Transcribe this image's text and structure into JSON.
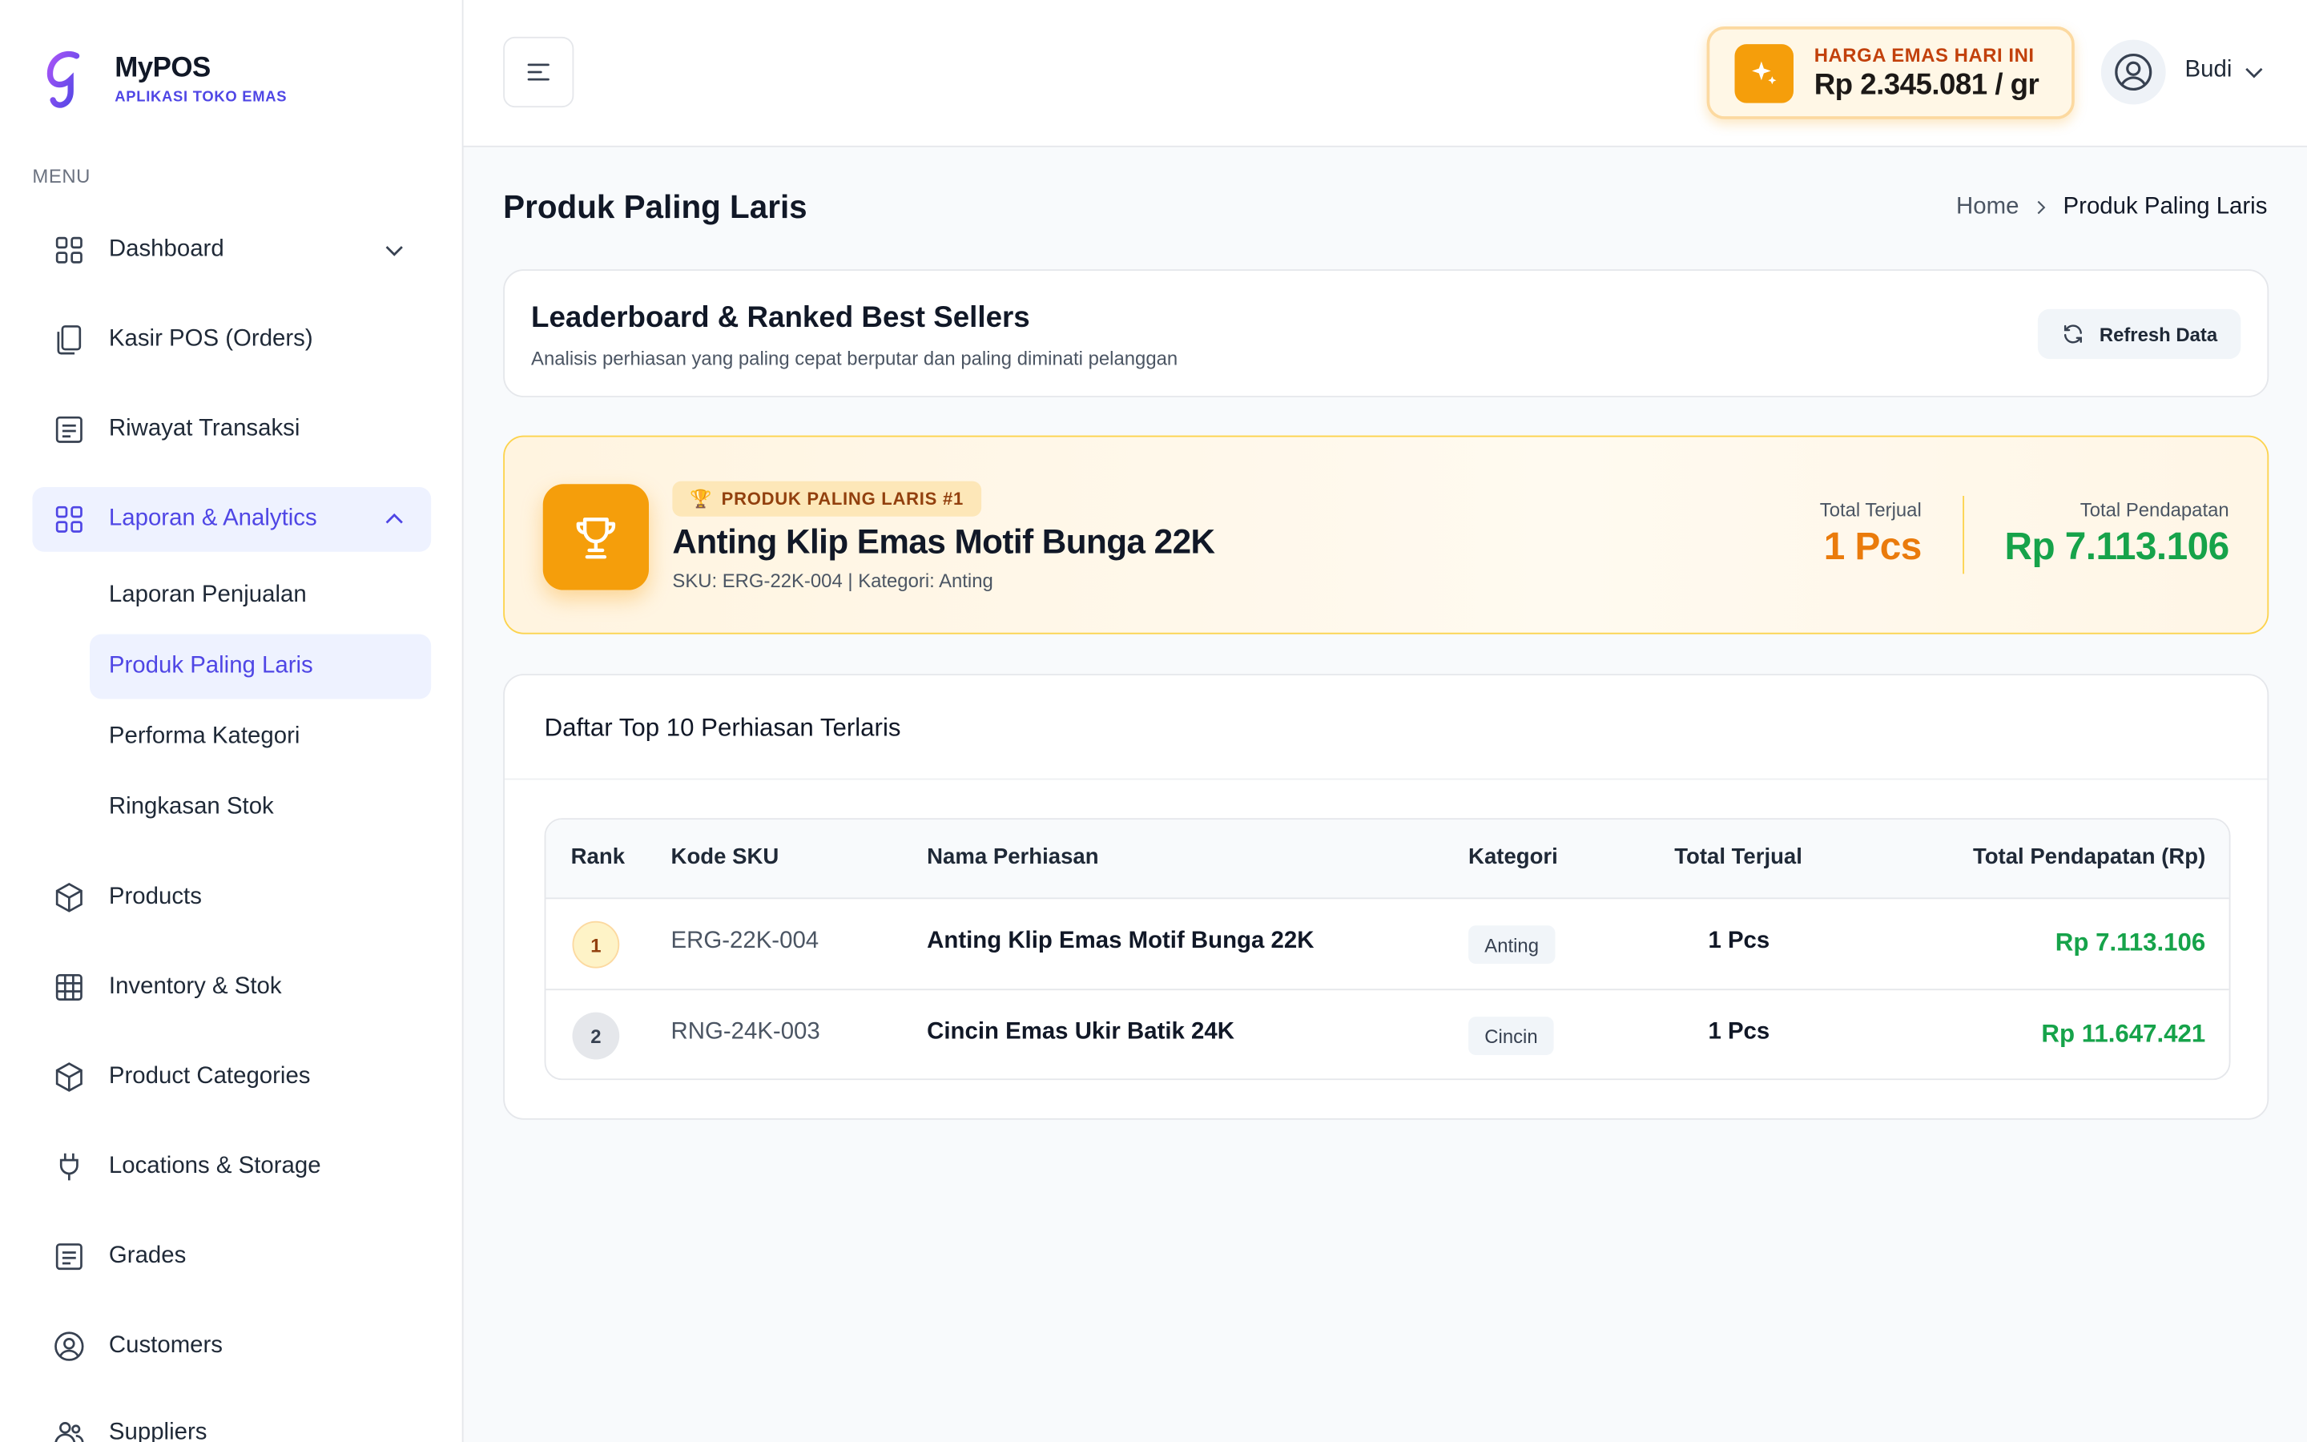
{
  "brand": {
    "name": "MyPOS",
    "subtitle": "APLIKASI TOKO EMAS"
  },
  "sidebar": {
    "menu_label": "MENU",
    "items": [
      {
        "label": "Dashboard",
        "icon": "grid-icon",
        "expandable": true,
        "expanded": false
      },
      {
        "label": "Kasir POS (Orders)",
        "icon": "copy-icon"
      },
      {
        "label": "Riwayat Transaksi",
        "icon": "list-icon"
      },
      {
        "label": "Laporan & Analytics",
        "icon": "grid-icon",
        "expandable": true,
        "expanded": true,
        "active": true
      },
      {
        "label": "Products",
        "icon": "box-icon"
      },
      {
        "label": "Inventory & Stok",
        "icon": "table-icon"
      },
      {
        "label": "Product Categories",
        "icon": "box-icon"
      },
      {
        "label": "Locations & Storage",
        "icon": "plug-icon"
      },
      {
        "label": "Grades",
        "icon": "list-icon"
      },
      {
        "label": "Customers",
        "icon": "user-circle-icon"
      },
      {
        "label": "Suppliers",
        "icon": "users-icon"
      }
    ],
    "subitems": [
      {
        "label": "Laporan Penjualan"
      },
      {
        "label": "Produk Paling Laris",
        "active": true
      },
      {
        "label": "Performa Kategori"
      },
      {
        "label": "Ringkasan Stok"
      }
    ]
  },
  "header": {
    "gold_label": "HARGA EMAS HARI INI",
    "gold_value": "Rp 2.345.081 / gr",
    "user_name": "Budi"
  },
  "page": {
    "title": "Produk Paling Laris",
    "breadcrumb_home": "Home",
    "breadcrumb_current": "Produk Paling Laris"
  },
  "leaderboard": {
    "title": "Leaderboard & Ranked Best Sellers",
    "subtitle": "Analisis perhiasan yang paling cepat berputar dan paling diminati pelanggan",
    "refresh_label": "Refresh Data"
  },
  "top_product": {
    "pill": "PRODUK PALING LARIS #1",
    "name": "Anting Klip Emas Motif Bunga 22K",
    "meta": "SKU: ERG-22K-004 | Kategori: Anting",
    "sold_label": "Total Terjual",
    "sold_value": "1 Pcs",
    "revenue_label": "Total Pendapatan",
    "revenue_value": "Rp 7.113.106"
  },
  "table": {
    "title": "Daftar Top 10 Perhiasan Terlaris",
    "headers": {
      "rank": "Rank",
      "sku": "Kode SKU",
      "name": "Nama Perhiasan",
      "category": "Kategori",
      "sold": "Total Terjual",
      "revenue": "Total Pendapatan (Rp)"
    },
    "rows": [
      {
        "rank": "1",
        "sku": "ERG-22K-004",
        "name": "Anting Klip Emas Motif Bunga 22K",
        "category": "Anting",
        "sold": "1 Pcs",
        "revenue": "Rp 7.113.106"
      },
      {
        "rank": "2",
        "sku": "RNG-24K-003",
        "name": "Cincin Emas Ukir Batik 24K",
        "category": "Cincin",
        "sold": "1 Pcs",
        "revenue": "Rp 11.647.421"
      }
    ]
  },
  "colors": {
    "accent": "#4f46e5",
    "gold": "#f59e0b",
    "revenue_green": "#16a34a",
    "sold_orange": "#ea7b0c"
  }
}
